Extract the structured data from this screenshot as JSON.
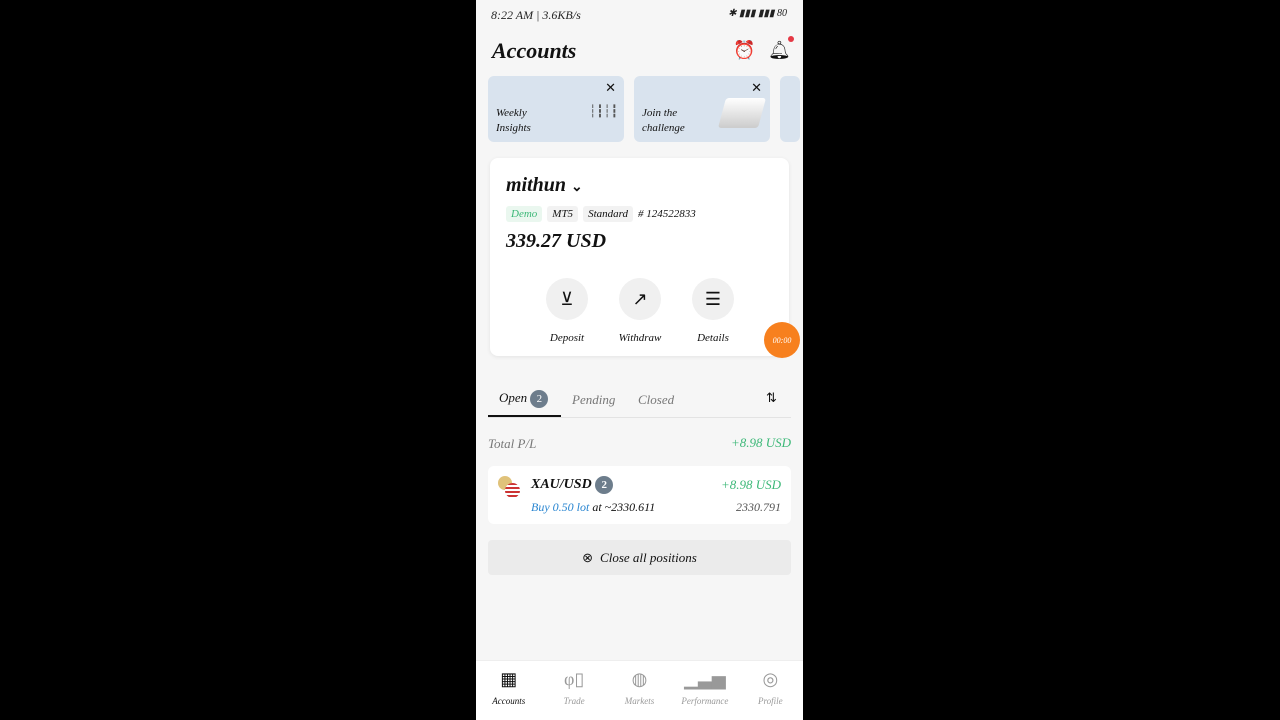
{
  "status_bar": {
    "time": "8:22 AM | 3.6KB/s",
    "battery": "80"
  },
  "header": {
    "title": "Accounts"
  },
  "promos": [
    {
      "label_line1": "Weekly",
      "label_line2": "Insights"
    },
    {
      "label_line1": "Join the",
      "label_line2": "challenge"
    }
  ],
  "account": {
    "name": "mithun",
    "tags": [
      "Demo",
      "MT5",
      "Standard"
    ],
    "number": "# 124522833",
    "balance": "339.27 USD",
    "actions": [
      {
        "label": "Deposit"
      },
      {
        "label": "Withdraw"
      },
      {
        "label": "Details"
      }
    ]
  },
  "timer": "00:00",
  "tabs": [
    {
      "label": "Open",
      "count": "2"
    },
    {
      "label": "Pending"
    },
    {
      "label": "Closed"
    }
  ],
  "total_pl": {
    "label": "Total P/L",
    "value": "+8.98 USD"
  },
  "position": {
    "symbol": "XAU/USD",
    "count": "2",
    "pl": "+8.98 USD",
    "side": "Buy 0.50 lot",
    "at": "at ~2330.611",
    "current": "2330.791"
  },
  "close_all": "Close all positions",
  "nav": [
    {
      "label": "Accounts"
    },
    {
      "label": "Trade"
    },
    {
      "label": "Markets"
    },
    {
      "label": "Performance"
    },
    {
      "label": "Profile"
    }
  ],
  "colors": {
    "green": "#3cb878",
    "blue": "#2a86d1",
    "accent": "#f7801e"
  }
}
